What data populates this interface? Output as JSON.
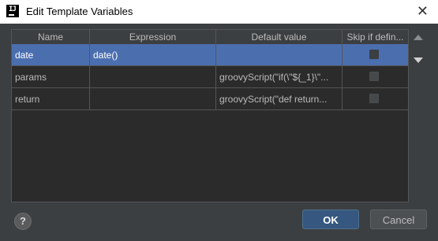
{
  "window": {
    "icon_text": "IJ",
    "title": "Edit Template Variables",
    "close_glyph": "✕"
  },
  "table": {
    "columns": [
      "Name",
      "Expression",
      "Default value",
      "Skip if defin..."
    ],
    "rows": [
      {
        "name": "date",
        "expression": "date()",
        "default_value": "",
        "skip": false,
        "selected": true
      },
      {
        "name": "params",
        "expression": "",
        "default_value": "groovyScript(\"if(\\\"${_1}\\\"...",
        "skip": false,
        "selected": false
      },
      {
        "name": "return",
        "expression": "",
        "default_value": "groovyScript(\"def return...",
        "skip": false,
        "selected": false
      }
    ]
  },
  "side_controls": {
    "move_up_icon": "triangle-up",
    "move_down_icon": "triangle-down"
  },
  "footer": {
    "help_label": "?",
    "ok_label": "OK",
    "cancel_label": "Cancel"
  },
  "colors": {
    "background": "#3c3f41",
    "table_bg": "#2b2b2b",
    "selection": "#4b6eaf",
    "ok_button": "#365880"
  }
}
